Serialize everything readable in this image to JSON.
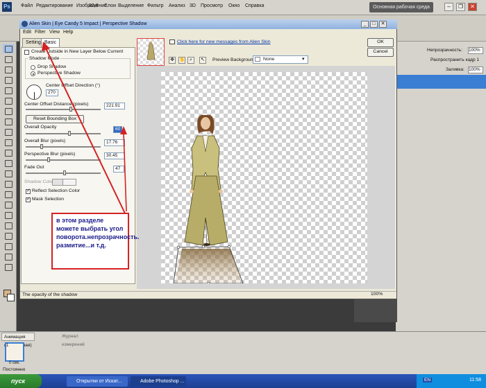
{
  "photoshop": {
    "logo": "Ps",
    "menu": [
      "Файл",
      "Редактирование",
      "Изображение",
      "Слои",
      "Выделение",
      "Фильтр",
      "Анализ",
      "3D",
      "Просмотр",
      "Окно",
      "Справка"
    ],
    "zoom": "82,6",
    "workspace_button": "Основная рабочая среда",
    "window_buttons": [
      "–",
      "❐",
      "✕"
    ],
    "right_panel": {
      "opacity_label": "Непрозрачность:",
      "opacity_value": "100%",
      "propagate_label": "Распространить кадр 1",
      "fill_label": "Заливка:",
      "fill_value": "100%"
    },
    "animation_panel": {
      "tabs": [
        "Анимация (покадровая)",
        "Журнал измерений"
      ],
      "frame_time": "0 сек.",
      "frame_number": "1",
      "loop": "Постоянно"
    }
  },
  "taskbar": {
    "start": "пуск",
    "items": [
      "Открытки от Искат...",
      "Adobe Photoshop ..."
    ],
    "lang": "EN",
    "clock": "11:58"
  },
  "dialog": {
    "title": "Alien Skin | Eye Candy 5 Impact | Perspective Shadow",
    "window_buttons": [
      "_",
      "□",
      "✕"
    ],
    "menu": [
      "Edit",
      "Filter",
      "View",
      "Help"
    ],
    "tabs": [
      "Settings",
      "Basic"
    ],
    "create_outside_label": "Create Outside in New Layer Below Current",
    "shadow_mode_label": "Shadow Mode",
    "shadow_mode_options": [
      "Drop Shadow",
      "Perspective Shadow"
    ],
    "center_offset_direction_label": "Center Offset Direction (°)",
    "center_offset_direction_value": "270",
    "center_offset_distance_label": "Center Offset Distance (pixels)",
    "center_offset_distance_value": "221.91",
    "reset_button": "Reset Bounding Box",
    "overall_opacity_label": "Overall Opacity",
    "overall_opacity_value": "60",
    "overall_blur_label": "Overall Blur (pixels)",
    "overall_blur_value": "17.76",
    "perspective_blur_label": "Perspective Blur (pixels)",
    "perspective_blur_value": "30.45",
    "fade_out_label": "Fade Out",
    "fade_out_value": "47",
    "shadow_color_label": "Shadow Color",
    "reflect_label": "Reflect Selection Color",
    "mask_label": "Mask Selection",
    "message_link": "Click here for new messages from Alien Skin",
    "preview_background_label": "Preview Background:",
    "preview_background_value": "None",
    "ok_button": "OK",
    "cancel_button": "Cancel",
    "status_text": "The opacity of the shadow",
    "status_zoom": "100%"
  },
  "annotation": {
    "text": "в этом разделе можете выбрать угол поворота.непрозрачность. размитие...и т.д."
  }
}
